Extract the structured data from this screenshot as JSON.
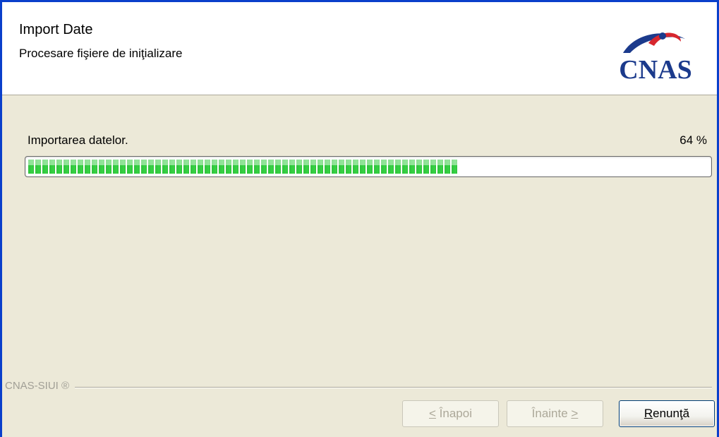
{
  "header": {
    "title": "Import Date",
    "subtitle": "Procesare fişiere de iniţializare",
    "logo_text": "CNAS"
  },
  "progress": {
    "status_text": "Importarea datelor.",
    "percent_text": "64 %",
    "fraction": 0.64,
    "fill_color": "#37D345"
  },
  "footer": {
    "brand_text": "CNAS-SIUI ®",
    "back_button": {
      "mnemonic": "<",
      "label": " Înapoi",
      "enabled": false
    },
    "next_button": {
      "label": "Înainte ",
      "mnemonic": ">",
      "enabled": false
    },
    "cancel_button": {
      "mnemonic": "R",
      "label": "enunţă",
      "enabled": true
    }
  },
  "colors": {
    "window_border": "#0A3FCB",
    "logo_blue": "#1B3A8C",
    "logo_red": "#D7262E"
  }
}
